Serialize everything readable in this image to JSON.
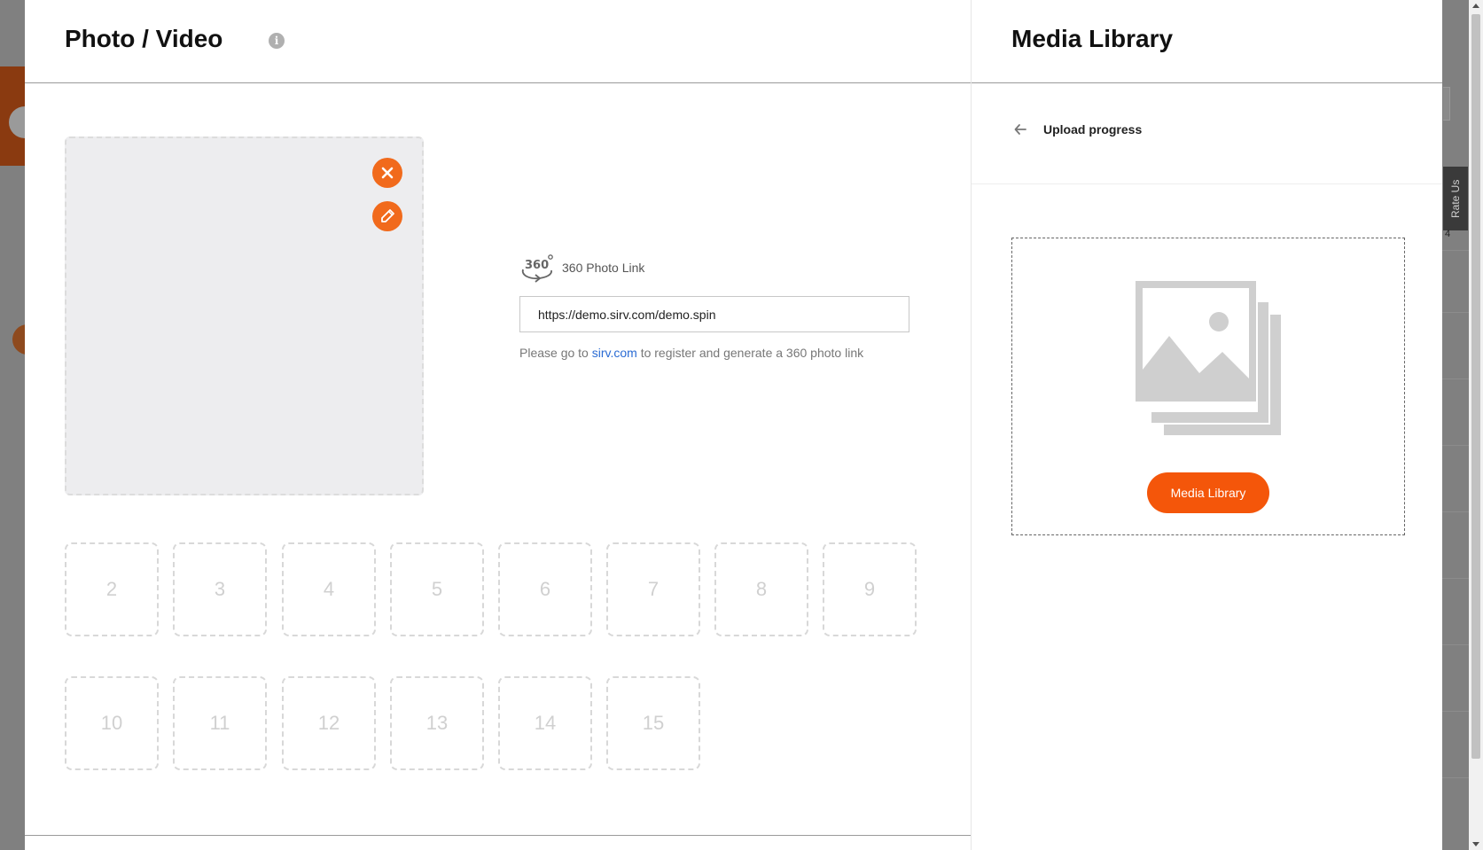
{
  "background": {
    "rate_label": "Rate Us",
    "rate_number": "4"
  },
  "modal": {
    "title": "Photo / Video",
    "info_icon": "info-icon",
    "main_photo": {
      "remove_icon": "close-icon",
      "edit_icon": "pencil-icon"
    },
    "link_section": {
      "icon": "360-icon",
      "label": "360 Photo Link",
      "input_value": "https://demo.sirv.com/demo.spin",
      "help_prefix": "Please go to ",
      "help_link": "sirv.com",
      "help_suffix": " to register and generate a 360 photo link"
    },
    "slots": [
      "2",
      "3",
      "4",
      "5",
      "6",
      "7",
      "8",
      "9",
      "10",
      "11",
      "12",
      "13",
      "14",
      "15"
    ]
  },
  "library": {
    "title": "Media Library",
    "back_icon": "arrow-left-icon",
    "progress_label": "Upload progress",
    "placeholder_icon": "image-stack-icon",
    "button_label": "Media Library"
  },
  "colors": {
    "accent": "#f16a1c",
    "button": "#f4560a",
    "link": "#2b6cd4"
  }
}
